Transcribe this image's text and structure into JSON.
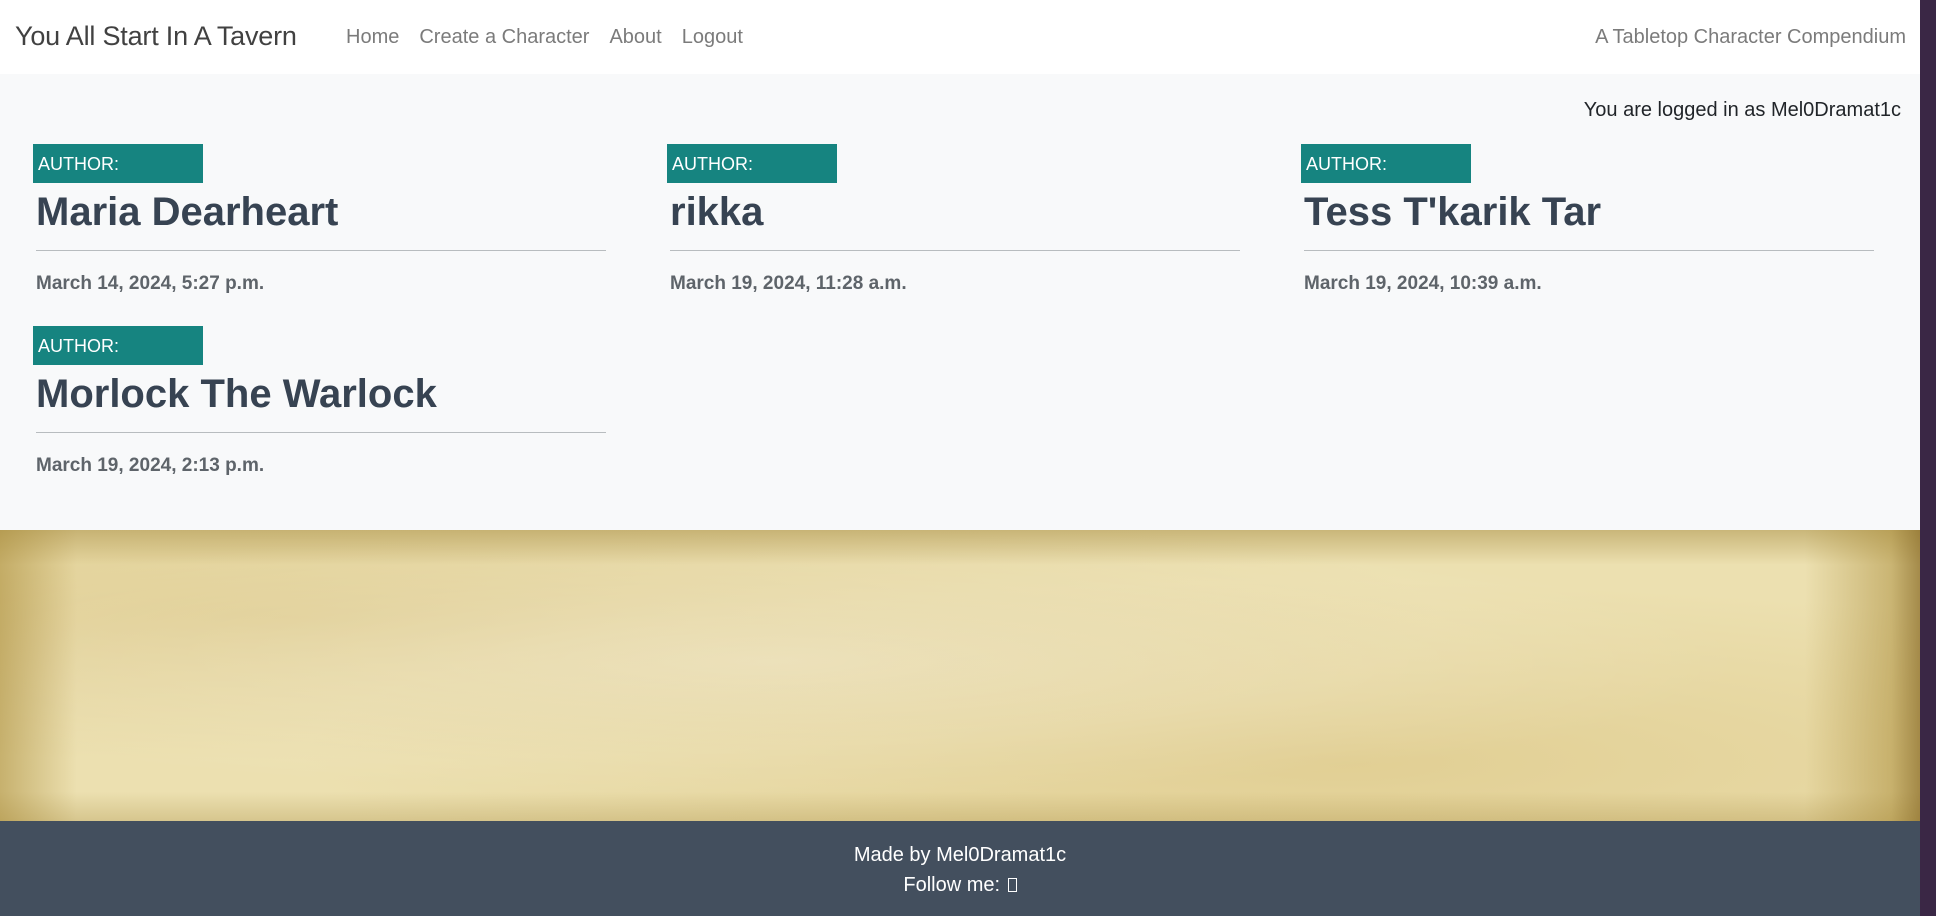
{
  "navbar": {
    "brand": "You All Start In A Tavern",
    "links": [
      "Home",
      "Create a Character",
      "About",
      "Logout"
    ],
    "tagline": "A Tabletop Character Compendium"
  },
  "status": {
    "logged_in_text": "You are logged in as Mel0Dramat1c"
  },
  "characters": [
    {
      "author_label": "AUTHOR:",
      "name": "Maria Dearheart",
      "date": "March 14, 2024, 5:27 p.m."
    },
    {
      "author_label": "AUTHOR:",
      "name": "rikka",
      "date": "March 19, 2024, 11:28 a.m."
    },
    {
      "author_label": "AUTHOR:",
      "name": "Tess T'karik Tar",
      "date": "March 19, 2024, 10:39 a.m."
    },
    {
      "author_label": "AUTHOR:",
      "name": "Morlock The Warlock",
      "date": "March 19, 2024, 2:13 p.m."
    }
  ],
  "footer": {
    "made_by": "Made by Mel0Dramat1c",
    "follow_label": "Follow me:",
    "social_icon": "social-link-icon"
  },
  "colors": {
    "author_badge": "#168480",
    "footer_bg": "#434f5e",
    "page_bg": "#f8f9fa"
  }
}
